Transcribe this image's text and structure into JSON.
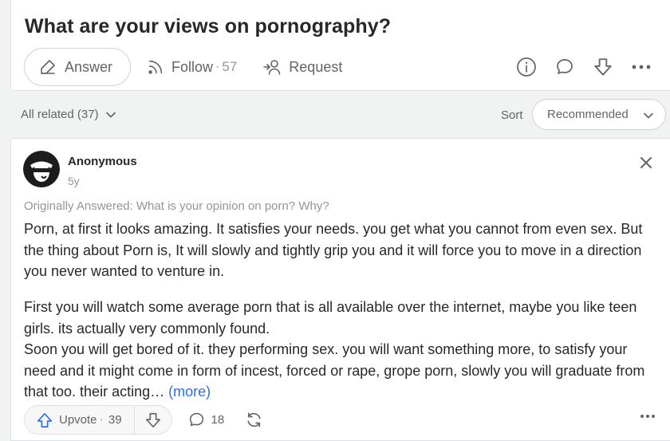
{
  "question": {
    "title": "What are your views on pornography?",
    "answer_label": "Answer",
    "follow_label": "Follow",
    "follow_count": "57",
    "request_label": "Request"
  },
  "related": {
    "label": "All related (37)",
    "sort_label": "Sort",
    "sort_value": "Recommended"
  },
  "answer": {
    "author": "Anonymous",
    "age": "5y",
    "originally": "Originally Answered: What is your opinion on porn? Why?",
    "para1": "Porn, at first it looks amazing. It satisfies your needs. you get what you cannot from even sex. But the thing about Porn is, It will slowly and tightly grip you and it will force you to move in a direction you never wanted to venture in.",
    "para2_line1": "First you will watch some average porn that is all available over the internet, maybe you like teen girls. its actually very commonly found.",
    "para2_line2": "Soon you will get bored of it. they performing sex. you will want something more, to satisfy your need and it might come in form of incest, forced or rape, grope porn, slowly you will graduate from that too. their acting…",
    "more_link": "(more)",
    "upvote_label": "Upvote",
    "upvote_count": "39",
    "comment_count": "18"
  },
  "colors": {
    "accent": "#2e69ff",
    "text": "#282829",
    "muted": "#636466",
    "border": "#dee0e1"
  }
}
